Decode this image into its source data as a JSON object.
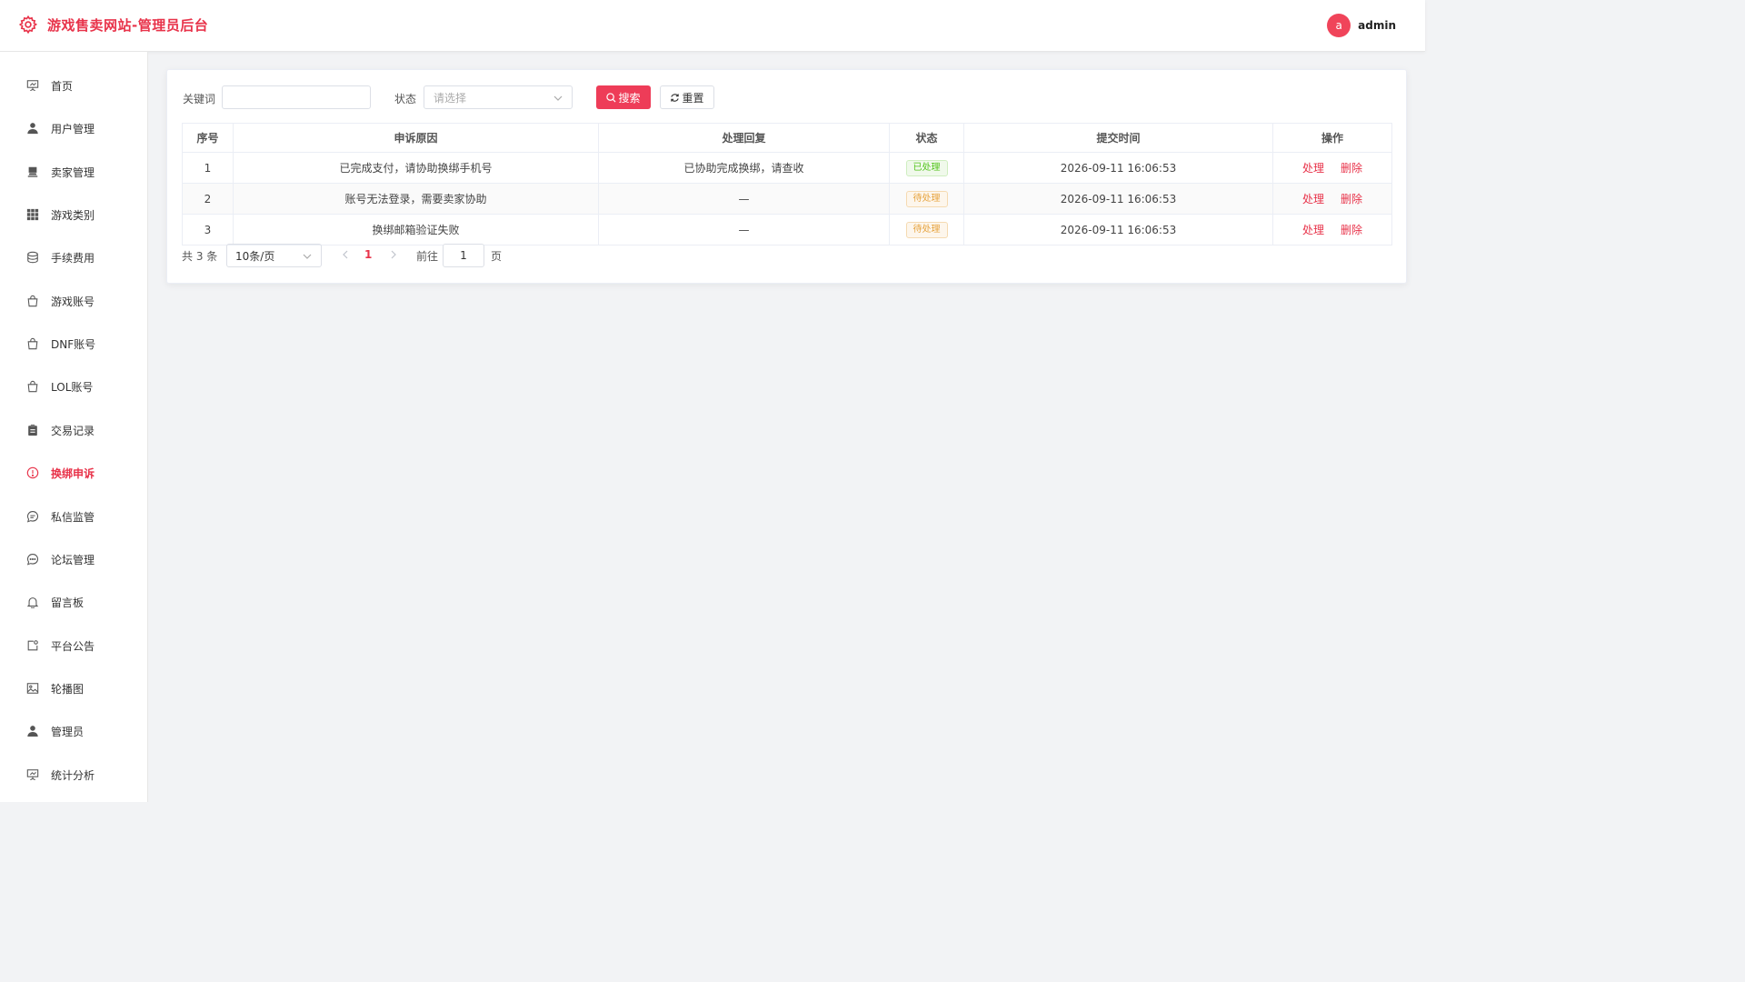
{
  "app": {
    "title": "游戏售卖网站-管理员后台",
    "brand_color": "#e8334a"
  },
  "user": {
    "avatar_letter": "a",
    "name": "admin"
  },
  "sidebar": {
    "items": [
      {
        "label": "首页",
        "icon": "presentation-icon"
      },
      {
        "label": "用户管理",
        "icon": "user-icon"
      },
      {
        "label": "卖家管理",
        "icon": "stamp-icon"
      },
      {
        "label": "游戏类别",
        "icon": "grid-icon"
      },
      {
        "label": "手续费用",
        "icon": "coins-icon"
      },
      {
        "label": "游戏账号",
        "icon": "bag-icon"
      },
      {
        "label": "DNF账号",
        "icon": "bag-icon"
      },
      {
        "label": "LOL账号",
        "icon": "bag-icon"
      },
      {
        "label": "交易记录",
        "icon": "clipboard-icon"
      },
      {
        "label": "换绑申诉",
        "icon": "warning-circle-icon",
        "active": true
      },
      {
        "label": "私信监管",
        "icon": "chat-icon"
      },
      {
        "label": "论坛管理",
        "icon": "chat-dots-icon"
      },
      {
        "label": "留言板",
        "icon": "bell-icon"
      },
      {
        "label": "平台公告",
        "icon": "notice-icon"
      },
      {
        "label": "轮播图",
        "icon": "picture-icon"
      },
      {
        "label": "管理员",
        "icon": "user-icon"
      },
      {
        "label": "统计分析",
        "icon": "presentation-icon"
      }
    ]
  },
  "filters": {
    "keyword_label": "关键词",
    "keyword_value": "",
    "status_label": "状态",
    "status_placeholder": "请选择",
    "search_label": "搜索",
    "reset_label": "重置"
  },
  "table": {
    "columns": [
      "序号",
      "申诉原因",
      "处理回复",
      "状态",
      "提交时间",
      "操作"
    ],
    "rows": [
      {
        "index": "1",
        "reason": "已完成支付，请协助换绑手机号",
        "reply": "已协助完成换绑，请查收",
        "status": "已处理",
        "status_type": "done",
        "time": "2026-09-11 16:06:53"
      },
      {
        "index": "2",
        "reason": "账号无法登录，需要卖家协助",
        "reply": "—",
        "status": "待处理",
        "status_type": "pending",
        "time": "2026-09-11 16:06:53"
      },
      {
        "index": "3",
        "reason": "换绑邮箱验证失败",
        "reply": "—",
        "status": "待处理",
        "status_type": "pending",
        "time": "2026-09-11 16:06:53"
      }
    ],
    "action_handle": "处理",
    "action_delete": "删除"
  },
  "pagination": {
    "total_text": "共 3 条",
    "page_size": "10条/页",
    "current_page": "1",
    "goto_label": "前往",
    "goto_value": "1",
    "page_suffix": "页"
  }
}
